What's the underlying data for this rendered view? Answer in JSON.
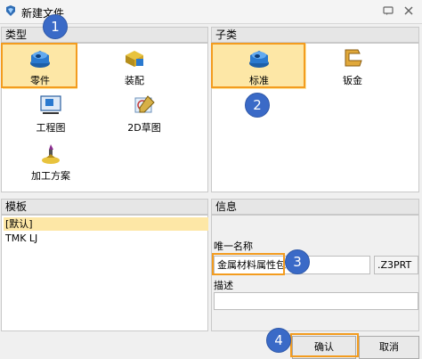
{
  "window": {
    "title": "新建文件",
    "icon": "app-logo-icon",
    "buttons": [
      "chat-icon",
      "close-icon"
    ]
  },
  "type_section": {
    "header": "类型",
    "items": [
      {
        "label": "零件",
        "icon": "part-icon",
        "selected": true
      },
      {
        "label": "装配",
        "icon": "assembly-icon",
        "selected": false
      },
      {
        "label": "工程图",
        "icon": "drawing-icon",
        "selected": false
      },
      {
        "label": "2D草图",
        "icon": "sketch-2d-icon",
        "selected": false
      },
      {
        "label": "加工方案",
        "icon": "machining-icon",
        "selected": false
      }
    ]
  },
  "subtype_section": {
    "header": "子类",
    "items": [
      {
        "label": "标准",
        "icon": "standard-part-icon",
        "selected": true
      },
      {
        "label": "钣金",
        "icon": "sheet-metal-icon",
        "selected": false
      }
    ]
  },
  "template_section": {
    "header": "模板",
    "rows": [
      "[默认]",
      "TMK LJ"
    ],
    "selected_index": 0
  },
  "info_section": {
    "header": "信息",
    "name_label": "唯一名称",
    "name_value": "金属材料属性包",
    "extension": ".Z3PRT",
    "desc_label": "描述",
    "desc_value": ""
  },
  "buttons": {
    "confirm": "确认",
    "cancel": "取消"
  },
  "annotations": [
    "1",
    "2",
    "3",
    "4"
  ],
  "colors": {
    "selection": "#fde7a6",
    "highlight_box": "#f39c1f",
    "badge": "#3a6ac7"
  }
}
